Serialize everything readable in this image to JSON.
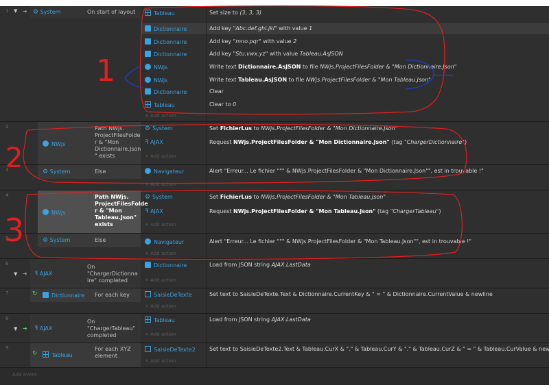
{
  "events": [
    {
      "num": "1",
      "condition": {
        "object": "System",
        "text": "On start of layout"
      },
      "actions": [
        {
          "object": "Tableau",
          "text": "Set size to ",
          "italic": "(3, 3, 3)"
        },
        {
          "object": "Dictionnaire",
          "text": "Add key ",
          "italic": "\"Abc.def.ghi.jkl\"",
          "text2": " with value ",
          "italic2": "1"
        },
        {
          "object": "Dictionnaire",
          "text": "Add key ",
          "italic": "\"mno.pqr\"",
          "text2": " with value ",
          "italic2": "2"
        },
        {
          "object": "Dictionnaire",
          "text": "Add key ",
          "italic": "\"Stu.vwx.yz\"",
          "text2": " with value ",
          "italic2": "Tableau.AsJSON"
        },
        {
          "object": "NWjs",
          "text": "Write text ",
          "bold": "Dictionnaire.AsJSON",
          "text2": " to file ",
          "italic2": "NWjs.ProjectFilesFolder & \"Mon Dictionnaire.Json\""
        },
        {
          "object": "NWjs",
          "text": "Write text ",
          "bold": "Tableau.AsJSON",
          "text2": " to file ",
          "italic2": "NWjs.ProjectFilesFolder & \"Mon Tableau.Json\""
        },
        {
          "object": "Dictionnaire",
          "text": "Clear"
        },
        {
          "object": "Tableau",
          "text": "Clear to ",
          "italic": "0"
        }
      ]
    },
    {
      "num": "2",
      "condition": {
        "object": "NWjs",
        "text": "Path NWjs. ProjectFilesFolde r & \"Mon Dictionnaire.Json \" exists"
      },
      "actions": [
        {
          "object": "System",
          "text": "Set ",
          "bold": "FichierLus",
          "text2": " to ",
          "italic2": "NWjs.ProjectFilesFolder & \"Mon Dictionnaire.Json\""
        },
        {
          "object": "AJAX",
          "text": "Request ",
          "bold": "NWjs.ProjectFilesFolder & \"Mon Dictionnaire.Json\"",
          "text2": " (tag ",
          "italic2": "\"ChargerDictionnaire\"",
          "text3": ")"
        }
      ]
    },
    {
      "num": "3",
      "condition": {
        "object": "System",
        "text": "Else"
      },
      "actions": [
        {
          "object": "Navigateur",
          "text": "Alert \"Erreur... Le fichier \"\"\" & NWjs.ProjectFilesFolder & \"Mon Dictionnaire.Json\"\", est in trouvable !\""
        }
      ]
    },
    {
      "num": "4",
      "condition": {
        "object": "NWjs",
        "text": "Path NWjs. ProjectFilesFolde r & \"Mon Tableau.Json\" exists"
      },
      "actions": [
        {
          "object": "System",
          "text": "Set ",
          "bold": "FichierLus",
          "text2": " to ",
          "italic2": "NWjs.ProjectFilesFolder & \"Mon Tableau.Json\""
        },
        {
          "object": "AJAX",
          "text": "Request ",
          "bold": "NWjs.ProjectFilesFolder & \"Mon Tableau.Json\"",
          "text2": " (tag ",
          "italic2": "\"ChargerTableau\"",
          "text3": ")"
        }
      ]
    },
    {
      "num": "5",
      "condition": {
        "object": "System",
        "text": "Else"
      },
      "actions": [
        {
          "object": "Navigateur",
          "text": "Alert \"Erreur... Le fichier \"\"\" & NWjs.ProjectFilesFolder & \"Mon Tableau.Json\"\", est in trouvable !\""
        }
      ]
    },
    {
      "num": "6",
      "condition": {
        "object": "AJAX",
        "text": "On \"ChargerDictionna ire\" completed"
      },
      "actions": [
        {
          "object": "Dictionnaire",
          "text": "Load from JSON string ",
          "italic": "AJAX.LastData"
        }
      ]
    },
    {
      "num": "7",
      "condition": {
        "object": "Dictionnaire",
        "text": "For each key"
      },
      "actions": [
        {
          "object": "SaisieDeTexte",
          "text": "Set text to SaisieDeTexte.Text & Dictionnaire.CurrentKey & \" = \" & Dictionnaire.CurrentValue & newline"
        }
      ]
    },
    {
      "num": "8",
      "condition": {
        "object": "AJAX",
        "text": "On \"ChargerTableau\" completed"
      },
      "actions": [
        {
          "object": "Tableau",
          "text": "Load from JSON string ",
          "italic": "AJAX.LastData"
        }
      ]
    },
    {
      "num": "9",
      "condition": {
        "object": "Tableau",
        "text": "For each XYZ element"
      },
      "actions": [
        {
          "object": "SaisieDeTexte2",
          "text": "Set text to SaisieDeTexte2.Text & Tableau.CurX & \".\" & Tableau.CurY & \".\" & Tableau.CurZ & \" = \" & Tableau.CurValue & newline"
        }
      ]
    }
  ],
  "labels": {
    "add_action": "+ Add action",
    "add_event": "Add event",
    "annot1": "1",
    "annot2": "2",
    "annot3": "3"
  },
  "colors": {
    "background": "#2b2b2b",
    "object_blue": "#3aa3e0",
    "trigger_green": "#5ec26a",
    "annotation_red": "#e02020",
    "annotation_blue": "#1e3fd0"
  }
}
